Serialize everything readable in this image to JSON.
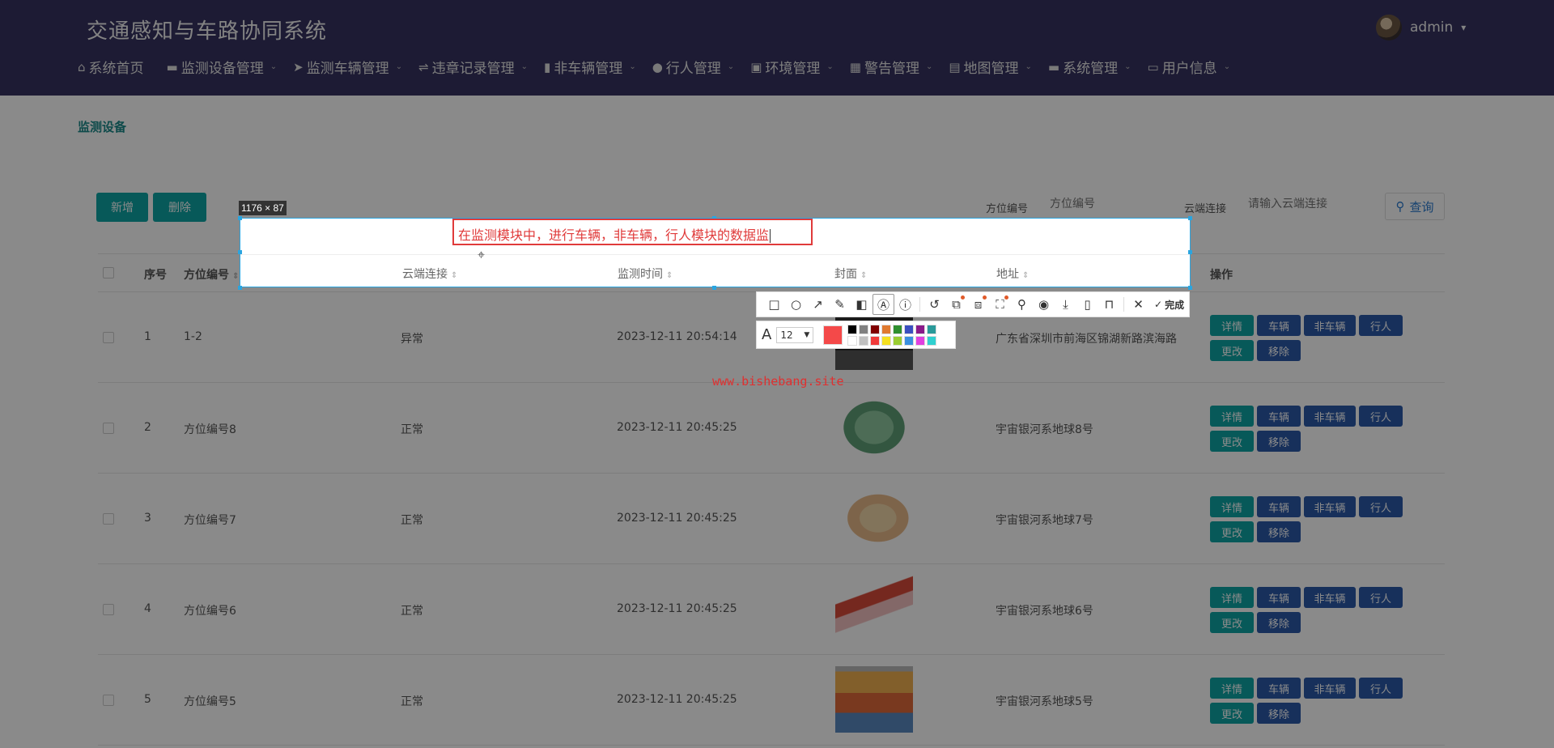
{
  "app": {
    "title": "交通感知与车路协同系统"
  },
  "user": {
    "name": "admin",
    "caret": "▾"
  },
  "nav": [
    {
      "icon": "⌂",
      "label": "系统首页",
      "chevron": ""
    },
    {
      "icon": "▬",
      "label": "监测设备管理",
      "chevron": "⌄"
    },
    {
      "icon": "➤",
      "label": "监测车辆管理",
      "chevron": "⌄"
    },
    {
      "icon": "⇌",
      "label": "违章记录管理",
      "chevron": "⌄"
    },
    {
      "icon": "▮",
      "label": "非车辆管理",
      "chevron": "⌄"
    },
    {
      "icon": "●",
      "label": "行人管理",
      "chevron": "⌄"
    },
    {
      "icon": "▣",
      "label": "环境管理",
      "chevron": "⌄"
    },
    {
      "icon": "▦",
      "label": "警告管理",
      "chevron": "⌄"
    },
    {
      "icon": "▤",
      "label": "地图管理",
      "chevron": "⌄"
    },
    {
      "icon": "▬",
      "label": "系统管理",
      "chevron": "⌄"
    },
    {
      "icon": "▭",
      "label": "用户信息",
      "chevron": "⌄"
    }
  ],
  "breadcrumb": "监测设备",
  "actions": {
    "add": "新增",
    "delete": "删除"
  },
  "filters": {
    "position_label": "方位编号",
    "position_placeholder": "方位编号",
    "cloud_label": "云端连接",
    "cloud_placeholder": "请输入云端连接",
    "search_label": "查询"
  },
  "table": {
    "columns": [
      "序号",
      "方位编号",
      "云端连接",
      "监测时间",
      "封面",
      "地址",
      "操作"
    ],
    "op_labels": {
      "detail": "详情",
      "vehicle": "车辆",
      "non_vehicle": "非车辆",
      "pedestrian": "行人",
      "edit": "更改",
      "remove": "移除"
    },
    "rows": [
      {
        "index": "1",
        "position": "1-2",
        "cloud": "异常",
        "time": "2023-12-11 20:54:14",
        "address": "广东省深圳市前海区锦湖新路滨海路"
      },
      {
        "index": "2",
        "position": "方位编号8",
        "cloud": "正常",
        "time": "2023-12-11 20:45:25",
        "address": "宇宙银河系地球8号"
      },
      {
        "index": "3",
        "position": "方位编号7",
        "cloud": "正常",
        "time": "2023-12-11 20:45:25",
        "address": "宇宙银河系地球7号"
      },
      {
        "index": "4",
        "position": "方位编号6",
        "cloud": "正常",
        "time": "2023-12-11 20:45:25",
        "address": "宇宙银河系地球6号"
      },
      {
        "index": "5",
        "position": "方位编号5",
        "cloud": "正常",
        "time": "2023-12-11 20:45:25",
        "address": "宇宙银河系地球5号"
      }
    ]
  },
  "capture": {
    "size_badge": "1176 × 87",
    "typed_text": "在监测模块中，进行车辆，非车辆，行人模块的数据监",
    "font_size": "12",
    "done_label": "完成",
    "current_color": "#f44949",
    "palette": [
      "#000000",
      "#808080",
      "#800000",
      "#e07a30",
      "#2f8f2f",
      "#3a4fc0",
      "#8a1a8a",
      "#2a9a9a",
      "#ffffff",
      "#c0c0c0",
      "#f03a3a",
      "#f5e020",
      "#9acd32",
      "#3a8fe0",
      "#e040e0",
      "#30d0d0"
    ]
  },
  "watermark": "www.bishebang.site"
}
